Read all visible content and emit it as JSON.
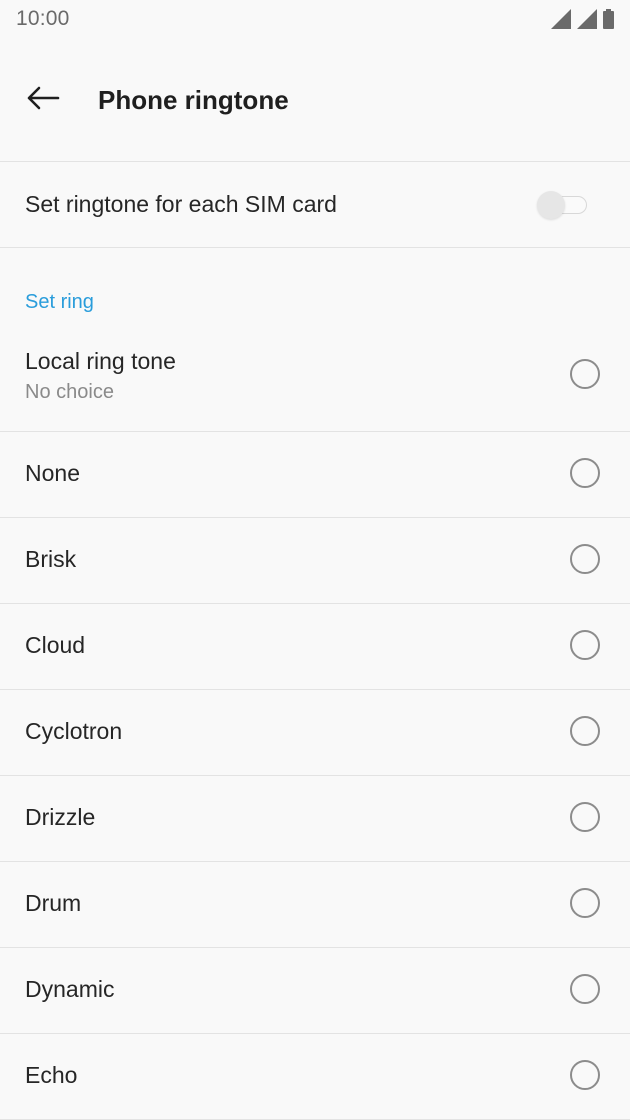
{
  "status_bar": {
    "time": "10:00",
    "icons": [
      "signal-icon",
      "signal-icon",
      "battery-icon"
    ]
  },
  "header": {
    "back_icon": "arrow-left-icon",
    "title": "Phone ringtone"
  },
  "sim_toggle": {
    "label": "Set ringtone for each SIM card",
    "enabled": false
  },
  "section": {
    "header": "Set ring"
  },
  "local_ringtone": {
    "title": "Local ring tone",
    "subtitle": "No choice",
    "selected": false
  },
  "ringtones": [
    {
      "label": "None",
      "selected": false
    },
    {
      "label": "Brisk",
      "selected": false
    },
    {
      "label": "Cloud",
      "selected": false
    },
    {
      "label": "Cyclotron",
      "selected": false
    },
    {
      "label": "Drizzle",
      "selected": false
    },
    {
      "label": "Drum",
      "selected": false
    },
    {
      "label": "Dynamic",
      "selected": false
    },
    {
      "label": "Echo",
      "selected": false
    }
  ],
  "colors": {
    "accent": "#2a9ddb",
    "background": "#f9f9f9",
    "divider": "#e3e3e3"
  }
}
